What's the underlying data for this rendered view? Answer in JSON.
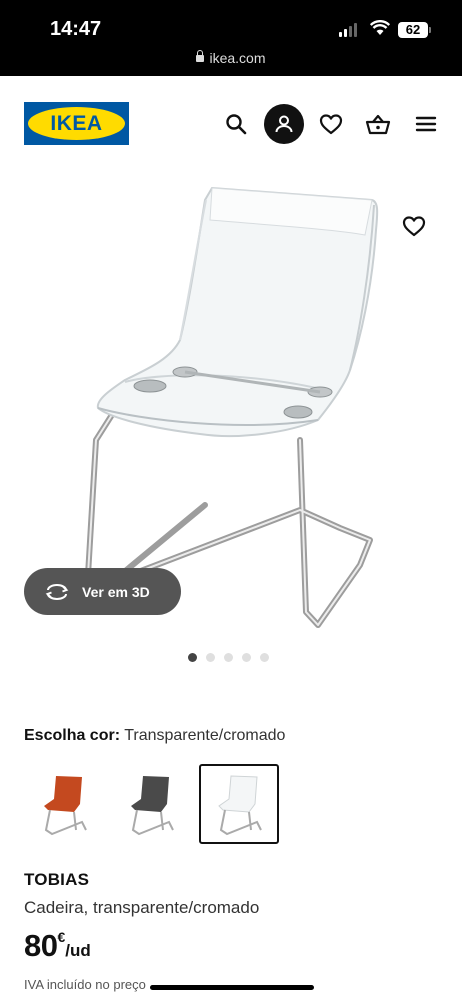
{
  "status_bar": {
    "time": "14:47",
    "battery": "62",
    "url": "ikea.com"
  },
  "header": {
    "logo_text": "IKEA",
    "icons": [
      "search-icon",
      "account-icon",
      "heart-icon",
      "basket-icon",
      "menu-icon"
    ]
  },
  "gallery": {
    "view_3d_label": "Ver em 3D",
    "image_count": 5,
    "active_index": 0
  },
  "product": {
    "color_label": "Escolha cor:",
    "color_value": "Transparente/cromado",
    "swatches": [
      {
        "color": "#c4491f",
        "selected": false
      },
      {
        "color": "#4a4a4a",
        "selected": false
      },
      {
        "color": "#e9eef0",
        "selected": true
      }
    ],
    "name": "TOBIAS",
    "description": "Cadeira, transparente/cromado",
    "price": "80",
    "currency": "€",
    "unit": "/ud",
    "vat_note": "IVA incluído no preço"
  },
  "colors": {
    "brand_blue": "#0058a3",
    "brand_yellow": "#ffdb00"
  }
}
